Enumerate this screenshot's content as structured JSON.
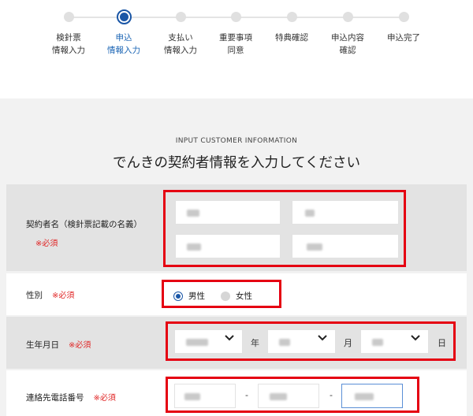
{
  "steps": [
    {
      "label": "検針票\n情報入力",
      "state": "todo"
    },
    {
      "label": "申込\n情報入力",
      "state": "current"
    },
    {
      "label": "支払い\n情報入力",
      "state": "todo"
    },
    {
      "label": "重要事項\n同意",
      "state": "todo"
    },
    {
      "label": "特典確認",
      "state": "todo"
    },
    {
      "label": "申込内容\n確認",
      "state": "todo"
    },
    {
      "label": "申込完了",
      "state": "todo"
    }
  ],
  "form": {
    "subheading": "INPUT CUSTOMER INFORMATION",
    "heading": "でんきの契約者情報を入力してください",
    "required_mark": "※必須",
    "name_label": "契約者名（検針票記載の名義）",
    "gender": {
      "label": "性別",
      "options": [
        "男性",
        "女性"
      ],
      "selected": "男性"
    },
    "birthdate": {
      "label": "生年月日",
      "year_unit": "年",
      "month_unit": "月",
      "day_unit": "日"
    },
    "phone": {
      "label": "連絡先電話番号",
      "separator": "-"
    }
  },
  "colors": {
    "accent": "#1a56a6",
    "required": "#e02424",
    "highlight_box": "#e50012"
  }
}
